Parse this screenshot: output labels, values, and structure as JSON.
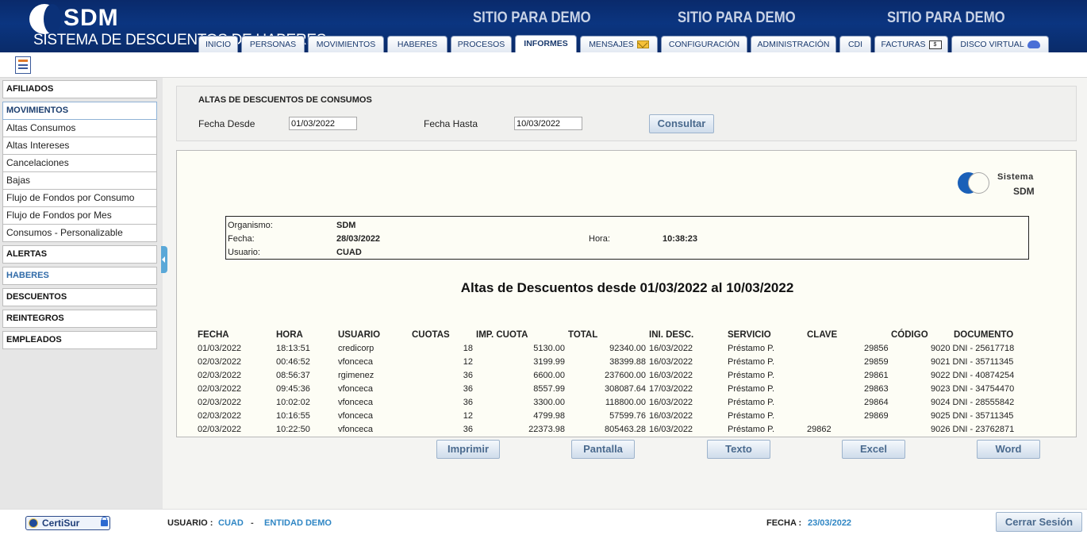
{
  "header": {
    "logo_text": "SDM",
    "logo_subtitle": "SISTEMA DE DESCUENTOS DE HABERES",
    "demo_banners": [
      "SITIO PARA DEMO",
      "SITIO PARA DEMO",
      "SITIO PARA DEMO"
    ],
    "tabs": [
      {
        "label": "INICIO"
      },
      {
        "label": "PERSONAS"
      },
      {
        "label": "MOVIMIENTOS"
      },
      {
        "label": "HABERES"
      },
      {
        "label": "PROCESOS"
      },
      {
        "label": "INFORMES",
        "active": true
      },
      {
        "label": "MENSAJES",
        "icon": "mail-icon"
      },
      {
        "label": "CONFIGURACIÓN"
      },
      {
        "label": "ADMINISTRACIÓN"
      },
      {
        "label": "CDI"
      },
      {
        "label": "FACTURAS",
        "icon": "bill-icon"
      },
      {
        "label": "DISCO VIRTUAL",
        "icon": "cloud-icon"
      }
    ],
    "bill_icon_text": "$"
  },
  "toolbar": {
    "icon": "report-icon"
  },
  "sidebar": {
    "afiliados": "AFILIADOS",
    "movimientos": "MOVIMIENTOS",
    "sub_items": [
      "Altas Consumos",
      "Altas Intereses",
      "Cancelaciones",
      "Bajas",
      "Flujo de Fondos por Consumo",
      "Flujo de Fondos por Mes",
      "Consumos - Personalizable"
    ],
    "alertas": "ALERTAS",
    "haberes": "HABERES",
    "descuentos": "DESCUENTOS",
    "reintegros": "REINTEGROS",
    "empleados": "EMPLEADOS"
  },
  "query": {
    "title": "ALTAS DE DESCUENTOS DE CONSUMOS",
    "desde_label": "Fecha Desde",
    "desde_value": "01/03/2022",
    "hasta_label": "Fecha Hasta",
    "hasta_value": "10/03/2022",
    "consultar_label": "Consultar"
  },
  "report": {
    "logo_line1": "Sistema",
    "logo_line2": "SDM",
    "info": {
      "organismo_label": "Organismo:",
      "organismo_value": "SDM",
      "fecha_label": "Fecha:",
      "fecha_value": "28/03/2022",
      "usuario_label": "Usuario:",
      "usuario_value": "CUAD",
      "hora_label": "Hora:",
      "hora_value": "10:38:23"
    },
    "title": "Altas de Descuentos desde 01/03/2022 al 10/03/2022",
    "columns": [
      "FECHA",
      "HORA",
      "USUARIO",
      "CUOTAS",
      "IMP. CUOTA",
      "TOTAL",
      "INI. DESC.",
      "SERVICIO",
      "CLAVE",
      "CÓDIGO",
      "DOCUMENTO"
    ],
    "rows": [
      {
        "fecha": "01/03/2022",
        "hora": "18:13:51",
        "usuario": "credicorp",
        "cuotas": "18",
        "imp": "5130.00",
        "total": "92340.00",
        "ini": "16/03/2022",
        "servicio": "Préstamo P.",
        "clave": "",
        "codigo": "29856",
        "documento": "9020 DNI - 25617718"
      },
      {
        "fecha": "02/03/2022",
        "hora": "00:46:52",
        "usuario": "vfonceca",
        "cuotas": "12",
        "imp": "3199.99",
        "total": "38399.88",
        "ini": "16/03/2022",
        "servicio": "Préstamo P.",
        "clave": "",
        "codigo": "29859",
        "documento": "9021 DNI - 35711345"
      },
      {
        "fecha": "02/03/2022",
        "hora": "08:56:37",
        "usuario": "rgimenez",
        "cuotas": "36",
        "imp": "6600.00",
        "total": "237600.00",
        "ini": "16/03/2022",
        "servicio": "Préstamo P.",
        "clave": "",
        "codigo": "29861",
        "documento": "9022 DNI - 40874254"
      },
      {
        "fecha": "02/03/2022",
        "hora": "09:45:36",
        "usuario": "vfonceca",
        "cuotas": "36",
        "imp": "8557.99",
        "total": "308087.64",
        "ini": "17/03/2022",
        "servicio": "Préstamo P.",
        "clave": "",
        "codigo": "29863",
        "documento": "9023 DNI - 34754470"
      },
      {
        "fecha": "02/03/2022",
        "hora": "10:02:02",
        "usuario": "vfonceca",
        "cuotas": "36",
        "imp": "3300.00",
        "total": "118800.00",
        "ini": "16/03/2022",
        "servicio": "Préstamo P.",
        "clave": "",
        "codigo": "29864",
        "documento": "9024 DNI - 28555842"
      },
      {
        "fecha": "02/03/2022",
        "hora": "10:16:55",
        "usuario": "vfonceca",
        "cuotas": "12",
        "imp": "4799.98",
        "total": "57599.76",
        "ini": "16/03/2022",
        "servicio": "Préstamo P.",
        "clave": "",
        "codigo": "29869",
        "documento": "9025 DNI - 35711345"
      },
      {
        "fecha": "02/03/2022",
        "hora": "10:22:50",
        "usuario": "vfonceca",
        "cuotas": "36",
        "imp": "22373.98",
        "total": "805463.28",
        "ini": "16/03/2022",
        "servicio": "Préstamo P.",
        "clave": "29862",
        "codigo": "",
        "documento": "9026 DNI - 23762871"
      }
    ]
  },
  "output_buttons": [
    "Imprimir",
    "Pantalla",
    "Texto",
    "Excel",
    "Word"
  ],
  "footer": {
    "certi_label": "CertiSur",
    "usuario_label": "USUARIO :",
    "usuario_value": "CUAD",
    "separator": "-",
    "entidad_value": "ENTIDAD DEMO",
    "fecha_label": "FECHA :",
    "fecha_value": "23/03/2022",
    "logout_label": "Cerrar Sesión"
  }
}
